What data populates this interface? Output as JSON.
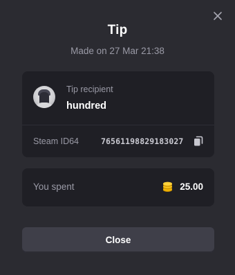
{
  "dialog": {
    "title": "Tip",
    "subtitle": "Made on 27 Mar 21:38",
    "close_icon": "close-icon"
  },
  "recipient": {
    "label": "Tip recipient",
    "name": "hundred",
    "avatar": "avatar-image",
    "steam_id_label": "Steam ID64",
    "steam_id_value": "76561198829183027",
    "copy_icon": "copy-icon"
  },
  "spent": {
    "label": "You spent",
    "coin_icon": "coin-icon",
    "amount": "25.00"
  },
  "footer": {
    "close_label": "Close"
  },
  "colors": {
    "background": "#2b2b31",
    "card": "#1f1f25",
    "button": "#3f3f49",
    "coin": "#f2b705",
    "muted_text": "#9a9aa6"
  }
}
